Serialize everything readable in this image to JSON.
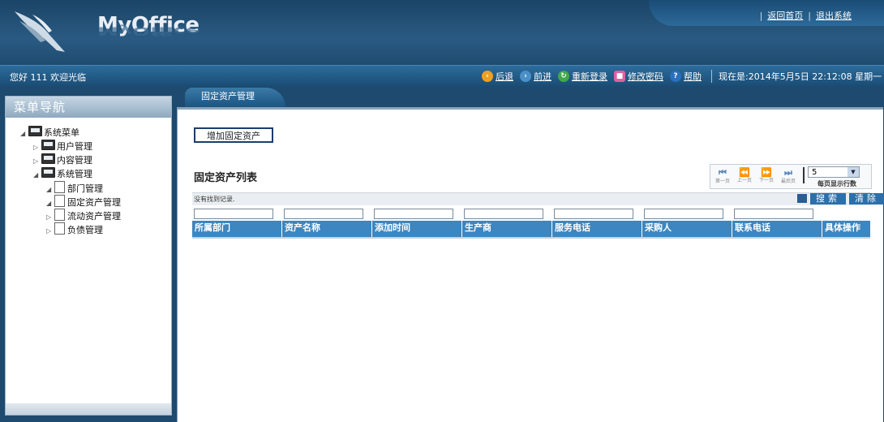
{
  "app": {
    "logo": "MyOffice"
  },
  "top_links": {
    "home": "返回首页",
    "logout": "退出系统"
  },
  "statusbar": {
    "welcome": "您好  111 欢迎光临",
    "back": "后退",
    "forward": "前进",
    "relogin": "重新登录",
    "change_password": "修改密码",
    "help": "帮助",
    "now": "现在是:2014年5月5日  22:12:08 星期一"
  },
  "sidebar": {
    "title": "菜单导航",
    "tree": {
      "root": "系统菜单",
      "user_mgmt": "用户管理",
      "content_mgmt": "内容管理",
      "system_mgmt": "系统管理",
      "dept_mgmt": "部门管理",
      "fixed_asset_mgmt": "固定资产管理",
      "current_asset_mgmt": "流动资产管理",
      "liability_mgmt": "负债管理"
    }
  },
  "tab": {
    "label": "固定资产管理"
  },
  "main": {
    "add_button": "增加固定资产",
    "list_title": "固定资产列表",
    "no_records": "没有找到记录.",
    "search_button": "搜索",
    "clear_button": "清除",
    "pager": {
      "first": "第一页",
      "prev": "上一页",
      "next": "下一页",
      "last": "最后页",
      "rows_per_page_value": "5",
      "rows_per_page_label": "每页显示行数"
    },
    "columns": [
      "所属部门",
      "资产名称",
      "添加时间",
      "生产商",
      "服务电话",
      "采购人",
      "联系电话",
      "具体操作"
    ]
  }
}
